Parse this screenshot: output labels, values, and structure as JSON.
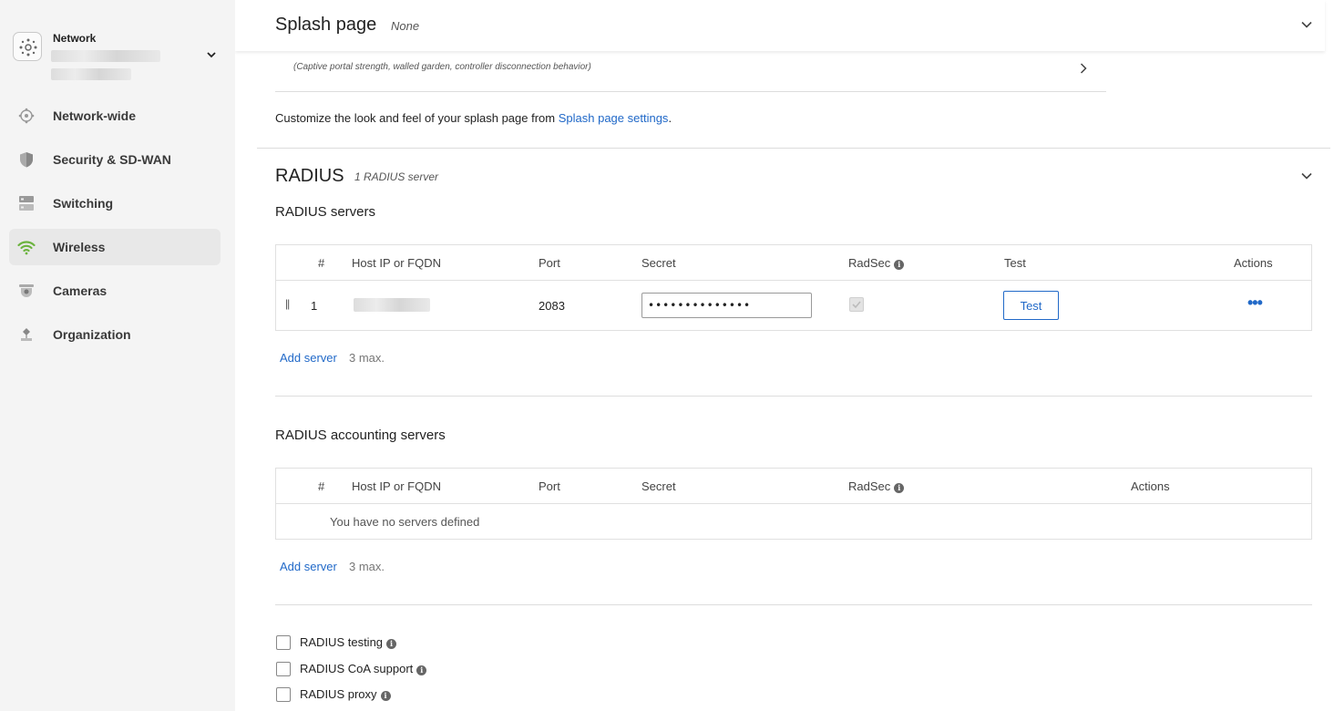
{
  "sidebar": {
    "network_label": "Network",
    "items": [
      {
        "label": "Network-wide",
        "icon": "network-wide-icon"
      },
      {
        "label": "Security & SD-WAN",
        "icon": "shield-icon"
      },
      {
        "label": "Switching",
        "icon": "switch-icon"
      },
      {
        "label": "Wireless",
        "icon": "wifi-icon",
        "active": true
      },
      {
        "label": "Cameras",
        "icon": "camera-icon"
      },
      {
        "label": "Organization",
        "icon": "organization-icon"
      }
    ]
  },
  "splash": {
    "title": "Splash page",
    "value": "None",
    "advanced_hint": "(Captive portal strength, walled garden, controller disconnection behavior)",
    "customize_prefix": "Customize the look and feel of your splash page from ",
    "customize_link": "Splash page settings",
    "customize_suffix": "."
  },
  "radius": {
    "title": "RADIUS",
    "subtitle": "1 RADIUS server",
    "servers": {
      "title": "RADIUS servers",
      "headers": {
        "num": "#",
        "host": "Host IP or FQDN",
        "port": "Port",
        "secret": "Secret",
        "radsec": "RadSec",
        "test": "Test",
        "actions": "Actions"
      },
      "rows": [
        {
          "handle": "||",
          "num": "1",
          "port": "2083",
          "secret": "••••••••••••••",
          "radsec_checked": true,
          "test_label": "Test",
          "actions_label": "•••"
        }
      ],
      "add_label": "Add server",
      "max_label": "3 max."
    },
    "accounting": {
      "title": "RADIUS accounting servers",
      "headers": {
        "num": "#",
        "host": "Host IP or FQDN",
        "port": "Port",
        "secret": "Secret",
        "radsec": "RadSec",
        "actions": "Actions"
      },
      "empty": "You have no servers defined",
      "add_label": "Add server",
      "max_label": "3 max."
    },
    "options": [
      {
        "label": "RADIUS testing",
        "checked": false
      },
      {
        "label": "RADIUS CoA support",
        "checked": false
      },
      {
        "label": "RADIUS proxy",
        "checked": false
      }
    ]
  },
  "colors": {
    "link": "#2169c8",
    "wireless_icon": "#6cb33f",
    "sidebar_bg": "#f4f4f4"
  }
}
